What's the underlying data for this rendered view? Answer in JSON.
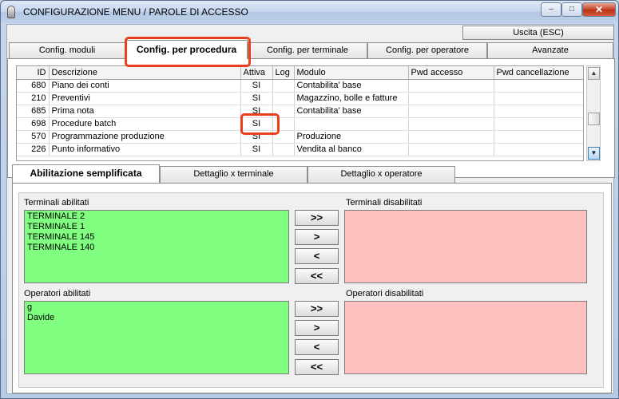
{
  "window": {
    "title": "CONFIGURAZIONE MENU / PAROLE DI ACCESSO",
    "controls": {
      "minimize": "–",
      "maximize": "□",
      "close": "✕"
    }
  },
  "toolbar": {
    "exit_label": "Uscita (ESC)"
  },
  "main_tabs": [
    {
      "label": "Config. moduli"
    },
    {
      "label": "Config. per procedura"
    },
    {
      "label": "Config. per terminale"
    },
    {
      "label": "Config. per operatore"
    },
    {
      "label": "Avanzate"
    }
  ],
  "procedures_table": {
    "columns": [
      "ID",
      "Descrizione",
      "Attiva",
      "Log",
      "Modulo",
      "Pwd accesso",
      "Pwd cancellazione"
    ],
    "rows": [
      {
        "id": "680",
        "descrizione": "Piano dei conti",
        "attiva": "SI",
        "log": "",
        "modulo": "Contabilita' base",
        "pwd_accesso": "",
        "pwd_canc": ""
      },
      {
        "id": "210",
        "descrizione": "Preventivi",
        "attiva": "SI",
        "log": "",
        "modulo": "Magazzino, bolle e fatture",
        "pwd_accesso": "",
        "pwd_canc": ""
      },
      {
        "id": "685",
        "descrizione": "Prima nota",
        "attiva": "SI",
        "log": "",
        "modulo": "Contabilita' base",
        "pwd_accesso": "",
        "pwd_canc": ""
      },
      {
        "id": "698",
        "descrizione": "Procedure batch",
        "attiva": "SI",
        "log": "",
        "modulo": "",
        "pwd_accesso": "",
        "pwd_canc": ""
      },
      {
        "id": "570",
        "descrizione": "Programmazione produzione",
        "attiva": "SI",
        "log": "",
        "modulo": "Produzione",
        "pwd_accesso": "",
        "pwd_canc": ""
      },
      {
        "id": "226",
        "descrizione": "Punto informativo",
        "attiva": "SI",
        "log": "",
        "modulo": "Vendita al banco",
        "pwd_accesso": "",
        "pwd_canc": ""
      }
    ]
  },
  "scrollbar": {
    "up": "▲",
    "down": "▼"
  },
  "sub_tabs": [
    {
      "label": "Abilitazione semplificata"
    },
    {
      "label": "Dettaglio x terminale"
    },
    {
      "label": "Dettaglio x operatore"
    }
  ],
  "terminals": {
    "enabled_label": "Terminali abilitati",
    "disabled_label": "Terminali disabilitati",
    "enabled": [
      "TERMINALE 2",
      "TERMINALE 1",
      "TERMINALE 145",
      "TERMINALE 140"
    ],
    "disabled": []
  },
  "operators": {
    "enabled_label": "Operatori abilitati",
    "disabled_label": "Operatori disabilitati",
    "enabled": [
      "g",
      "Davide"
    ],
    "disabled": []
  },
  "transfer_buttons": {
    "all_right": ">>",
    "one_right": ">",
    "one_left": "<",
    "all_left": "<<"
  },
  "colors": {
    "enabled_bg": "#80ff80",
    "disabled_bg": "#ffc0c0",
    "highlight": "#e8401c"
  }
}
